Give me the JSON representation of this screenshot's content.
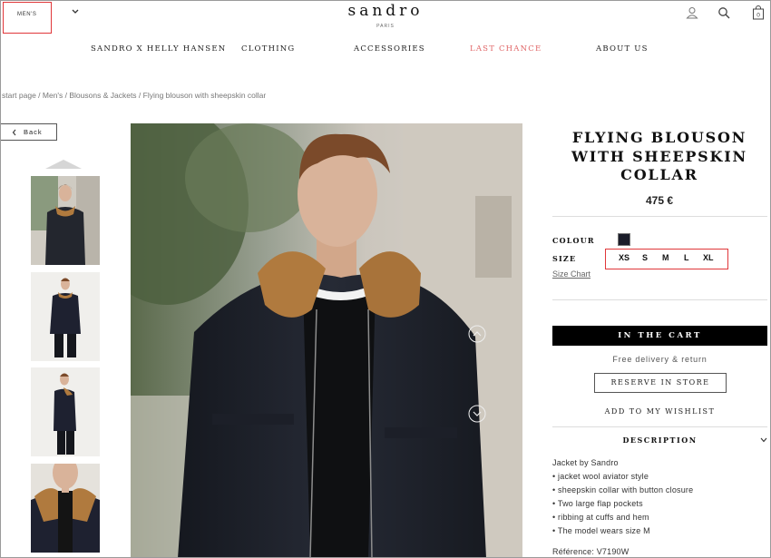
{
  "header": {
    "gender_selector": "MEN'S",
    "logo": "sandro",
    "logo_sub": "PARIS",
    "cart_count": "0",
    "icons": [
      "account-icon",
      "search-icon",
      "bag-icon"
    ]
  },
  "nav": [
    {
      "label": "SANDRO X HELLY HANSEN",
      "color": "#222222"
    },
    {
      "label": "CLOTHING",
      "color": "#222222"
    },
    {
      "label": "ACCESSORIES",
      "color": "#222222"
    },
    {
      "label": "LAST CHANCE",
      "color": "#e06566"
    },
    {
      "label": "ABOUT US",
      "color": "#222222"
    }
  ],
  "breadcrumb": "start page / Men's / Blousons & Jackets / Flying blouson with sheepskin collar",
  "back_label": "Back",
  "product": {
    "title_lines": [
      "FLYING BLOUSON",
      "WITH SHEEPSKIN",
      "COLLAR"
    ],
    "price": "475 €",
    "colour_label": "COLOUR",
    "colour_swatch": "#1b1d2a",
    "size_label": "SIZE",
    "sizes": [
      "XS",
      "S",
      "M",
      "L",
      "XL"
    ],
    "size_chart": "Size Chart",
    "cart_button": "IN THE CART",
    "free_delivery": "Free delivery & return",
    "reserve_button": "RESERVE IN STORE",
    "wishlist": "ADD TO MY WISHLIST",
    "description_heading": "DESCRIPTION",
    "description": [
      "Jacket by Sandro",
      "• jacket wool aviator style",
      "• sheepskin collar with button closure",
      "• Two large flap pockets",
      "• ribbing at cuffs and hem",
      "• The model wears size M",
      "",
      "Référence: V7190W"
    ]
  },
  "colors": {
    "highlight": "#e0373a",
    "sale": "#e06566",
    "jacket": "#1b1d2a",
    "collar": "#b07a3e"
  }
}
